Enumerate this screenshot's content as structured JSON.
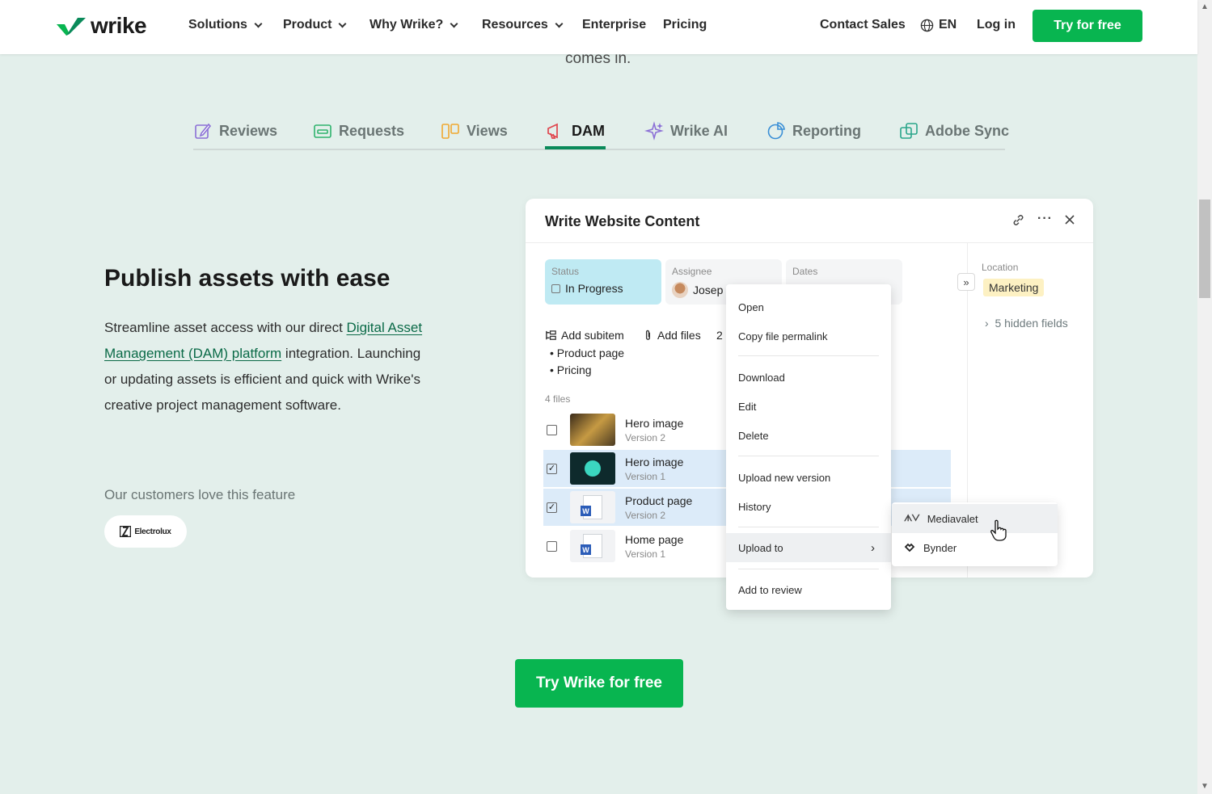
{
  "nav": {
    "logo_text": "wrike",
    "items": [
      {
        "label": "Solutions",
        "dropdown": true
      },
      {
        "label": "Product",
        "dropdown": true
      },
      {
        "label": "Why Wrike?",
        "dropdown": true
      },
      {
        "label": "Resources",
        "dropdown": true
      },
      {
        "label": "Enterprise",
        "dropdown": false
      },
      {
        "label": "Pricing",
        "dropdown": false
      }
    ],
    "contact_sales": "Contact Sales",
    "language": "EN",
    "login": "Log in",
    "cta": "Try for free"
  },
  "intro_tail": "comes in.",
  "tabs": [
    {
      "label": "Reviews",
      "icon": "edit-icon"
    },
    {
      "label": "Requests",
      "icon": "inbox-icon"
    },
    {
      "label": "Views",
      "icon": "board-icon"
    },
    {
      "label": "DAM",
      "icon": "megaphone-icon",
      "active": true
    },
    {
      "label": "Wrike AI",
      "icon": "sparkle-icon"
    },
    {
      "label": "Reporting",
      "icon": "pie-chart-icon"
    },
    {
      "label": "Adobe Sync",
      "icon": "sync-icon"
    }
  ],
  "feature": {
    "headline": "Publish assets with ease",
    "body_pre": "Streamline asset access with our direct ",
    "body_link": "Digital Asset Management (DAM) platform",
    "body_post": " integration. Launching or updating assets is efficient and quick with Wrike's creative project management software.",
    "customers_label": "Our customers love this feature",
    "customer_logo": "Electrolux"
  },
  "card": {
    "title": "Write Website Content",
    "status_label": "Status",
    "status_value": "In Progress",
    "assignee_label": "Assignee",
    "assignee_value": "Josep",
    "dates_label": "Dates",
    "add_subitem": "Add subitem",
    "add_files": "Add files",
    "count": "2",
    "bullets": [
      "Product page",
      "Pricing"
    ],
    "files_label": "4 files",
    "files": [
      {
        "name": "Hero image",
        "version": "Version 2",
        "checked": false,
        "thumb": "img1"
      },
      {
        "name": "Hero image",
        "version": "Version 1",
        "checked": true,
        "thumb": "img2"
      },
      {
        "name": "Product page",
        "version": "Version 2",
        "checked": true,
        "thumb": "doc"
      },
      {
        "name": "Home page",
        "version": "Version 1",
        "checked": false,
        "thumb": "doc"
      }
    ],
    "location_label": "Location",
    "location_value": "Marketing",
    "hidden_fields": "5 hidden fields"
  },
  "context_menu": {
    "items": [
      "Open",
      "Copy file permalink",
      "Download",
      "Edit",
      "Delete",
      "Upload new version",
      "History",
      "Upload to",
      "Add to review"
    ],
    "highlighted": "Upload to"
  },
  "submenu": {
    "items": [
      "Mediavalet",
      "Bynder"
    ],
    "highlighted": "Mediavalet"
  },
  "cta": "Try Wrike for free",
  "colors": {
    "brand_green": "#08b550",
    "accent_dark_green": "#0a8a5a",
    "background": "#e3efeb"
  }
}
